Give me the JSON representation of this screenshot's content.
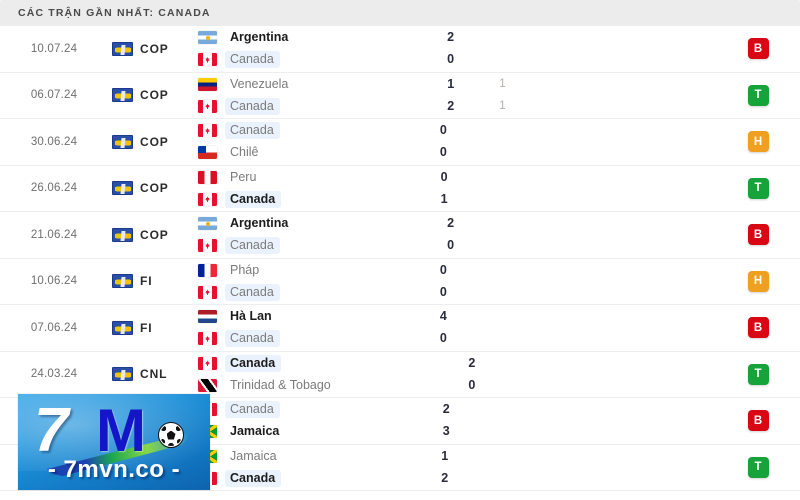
{
  "header": {
    "title": "CÁC TRẬN GẦN NHẤT: CANADA"
  },
  "colors": {
    "header_bg": "#ececec",
    "badge_loss": "#d90613",
    "badge_win": "#16a43a",
    "badge_draw": "#f0a020",
    "highlight": "#eaf2fd"
  },
  "matches": [
    {
      "date": "10.07.24",
      "competition": "COP",
      "competition_icon": "copa-america-flag-icon",
      "home_team": "Argentina",
      "home_flag": "argentina-flag-icon",
      "home_bold": true,
      "home_highlight": false,
      "home_score": "2",
      "home_ht": "",
      "away_team": "Canada",
      "away_flag": "canada-flag-icon",
      "away_bold": false,
      "away_highlight": true,
      "away_score": "0",
      "away_ht": "",
      "result": "B",
      "result_class": "badge-B"
    },
    {
      "date": "06.07.24",
      "competition": "COP",
      "competition_icon": "copa-america-flag-icon",
      "home_team": "Venezuela",
      "home_flag": "venezuela-flag-icon",
      "home_bold": false,
      "home_highlight": false,
      "home_score": "1",
      "home_ht": "1",
      "away_team": "Canada",
      "away_flag": "canada-flag-icon",
      "away_bold": false,
      "away_highlight": true,
      "away_score": "2",
      "away_ht": "1",
      "result": "T",
      "result_class": "badge-T"
    },
    {
      "date": "30.06.24",
      "competition": "COP",
      "competition_icon": "copa-america-flag-icon",
      "home_team": "Canada",
      "home_flag": "canada-flag-icon",
      "home_bold": false,
      "home_highlight": true,
      "home_score": "0",
      "home_ht": "",
      "away_team": "Chilê",
      "away_flag": "chile-flag-icon",
      "away_bold": false,
      "away_highlight": false,
      "away_score": "0",
      "away_ht": "",
      "result": "H",
      "result_class": "badge-H"
    },
    {
      "date": "26.06.24",
      "competition": "COP",
      "competition_icon": "copa-america-flag-icon",
      "home_team": "Peru",
      "home_flag": "peru-flag-icon",
      "home_bold": false,
      "home_highlight": false,
      "home_score": "0",
      "home_ht": "",
      "away_team": "Canada",
      "away_flag": "canada-flag-icon",
      "away_bold": true,
      "away_highlight": true,
      "away_score": "1",
      "away_ht": "",
      "result": "T",
      "result_class": "badge-T"
    },
    {
      "date": "21.06.24",
      "competition": "COP",
      "competition_icon": "copa-america-flag-icon",
      "home_team": "Argentina",
      "home_flag": "argentina-flag-icon",
      "home_bold": true,
      "home_highlight": false,
      "home_score": "2",
      "home_ht": "",
      "away_team": "Canada",
      "away_flag": "canada-flag-icon",
      "away_bold": false,
      "away_highlight": true,
      "away_score": "0",
      "away_ht": "",
      "result": "B",
      "result_class": "badge-B"
    },
    {
      "date": "10.06.24",
      "competition": "FI",
      "competition_icon": "friendly-flag-icon",
      "home_team": "Pháp",
      "home_flag": "france-flag-icon",
      "home_bold": false,
      "home_highlight": false,
      "home_score": "0",
      "home_ht": "",
      "away_team": "Canada",
      "away_flag": "canada-flag-icon",
      "away_bold": false,
      "away_highlight": true,
      "away_score": "0",
      "away_ht": "",
      "result": "H",
      "result_class": "badge-H"
    },
    {
      "date": "07.06.24",
      "competition": "FI",
      "competition_icon": "friendly-flag-icon",
      "home_team": "Hà Lan",
      "home_flag": "netherlands-flag-icon",
      "home_bold": true,
      "home_highlight": false,
      "home_score": "4",
      "home_ht": "",
      "away_team": "Canada",
      "away_flag": "canada-flag-icon",
      "away_bold": false,
      "away_highlight": true,
      "away_score": "0",
      "away_ht": "",
      "result": "B",
      "result_class": "badge-B"
    },
    {
      "date": "24.03.24",
      "competition": "CNL",
      "competition_icon": "concacaf-nations-league-flag-icon",
      "home_team": "Canada",
      "home_flag": "canada-flag-icon",
      "home_bold": true,
      "home_highlight": true,
      "home_score": "2",
      "home_ht": "",
      "away_team": "Trinidad & Tobago",
      "away_flag": "trinidad-and-tobago-flag-icon",
      "away_bold": false,
      "away_highlight": false,
      "away_score": "0",
      "away_ht": "",
      "result": "T",
      "result_class": "badge-T"
    },
    {
      "date": "",
      "competition": "",
      "competition_icon": "",
      "home_team": "Canada",
      "home_flag": "canada-flag-icon",
      "home_bold": false,
      "home_highlight": true,
      "home_score": "2",
      "home_ht": "",
      "away_team": "Jamaica",
      "away_flag": "jamaica-flag-icon",
      "away_bold": true,
      "away_highlight": false,
      "away_score": "3",
      "away_ht": "",
      "result": "B",
      "result_class": "badge-B"
    },
    {
      "date": "",
      "competition": "",
      "competition_icon": "",
      "home_team": "Jamaica",
      "home_flag": "jamaica-flag-icon",
      "home_bold": false,
      "home_highlight": false,
      "home_score": "1",
      "home_ht": "",
      "away_team": "Canada",
      "away_flag": "canada-flag-icon",
      "away_bold": true,
      "away_highlight": true,
      "away_score": "2",
      "away_ht": "",
      "result": "T",
      "result_class": "badge-T"
    }
  ],
  "watermark": {
    "seven": "7",
    "m": "M",
    "url": "- 7mvn.co -",
    "ball_icon": "soccer-ball-icon"
  }
}
